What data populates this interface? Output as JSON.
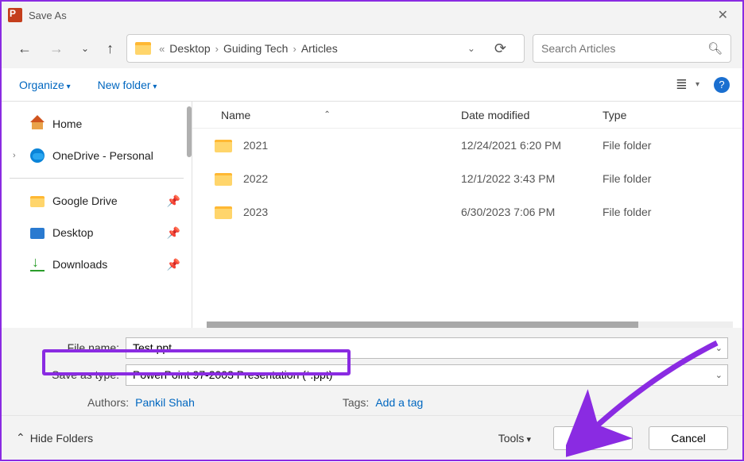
{
  "window": {
    "title": "Save As"
  },
  "breadcrumb": {
    "overflow": "«",
    "parts": [
      "Desktop",
      "Guiding Tech",
      "Articles"
    ]
  },
  "search": {
    "placeholder": "Search Articles"
  },
  "toolbar": {
    "organize": "Organize",
    "newfolder": "New folder"
  },
  "sidebar": {
    "home": "Home",
    "onedrive": "OneDrive - Personal",
    "gdrive": "Google Drive",
    "desktop": "Desktop",
    "downloads": "Downloads"
  },
  "columns": {
    "name": "Name",
    "date": "Date modified",
    "type": "Type"
  },
  "files": [
    {
      "name": "2021",
      "date": "12/24/2021 6:20 PM",
      "type": "File folder"
    },
    {
      "name": "2022",
      "date": "12/1/2022 3:43 PM",
      "type": "File folder"
    },
    {
      "name": "2023",
      "date": "6/30/2023 7:06 PM",
      "type": "File folder"
    }
  ],
  "filename": {
    "label": "File name:",
    "value": "Test.ppt"
  },
  "filetype": {
    "label": "Save as type:",
    "value": "PowerPoint 97-2003 Presentation (*.ppt)"
  },
  "meta": {
    "authors_label": "Authors:",
    "authors_value": "Pankil Shah",
    "tags_label": "Tags:",
    "tags_value": "Add a tag"
  },
  "footer": {
    "hide": "Hide Folders",
    "tools": "Tools",
    "save": "Save",
    "cancel": "Cancel"
  }
}
